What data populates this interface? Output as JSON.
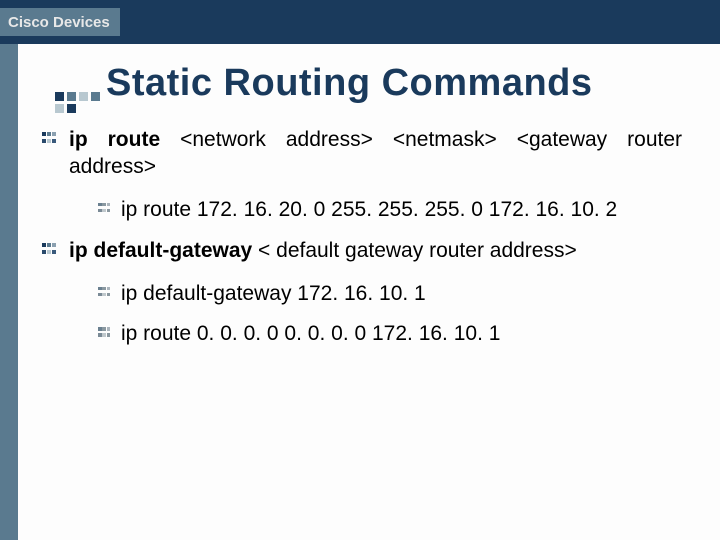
{
  "header": {
    "label": "Cisco Devices"
  },
  "title": "Static Routing Commands",
  "bullets": [
    {
      "level": 1,
      "cmd": "ip  route",
      "args": "  <network  address>   <netmask>   <gateway router address>"
    },
    {
      "level": 2,
      "text": "ip route 172. 16. 20. 0 255. 255. 255. 0 172. 16. 10. 2"
    },
    {
      "level": 1,
      "cmd": "ip default-gateway",
      "args": " < default gateway router address>"
    },
    {
      "level": 2,
      "text": "ip default-gateway 172. 16. 10. 1"
    },
    {
      "level": 2,
      "text": "ip route 0. 0. 0. 0 0. 0. 0. 0 172. 16. 10. 1"
    }
  ],
  "colors": {
    "header_bg": "#1a3a5c",
    "accent": "#5a7a8f"
  }
}
